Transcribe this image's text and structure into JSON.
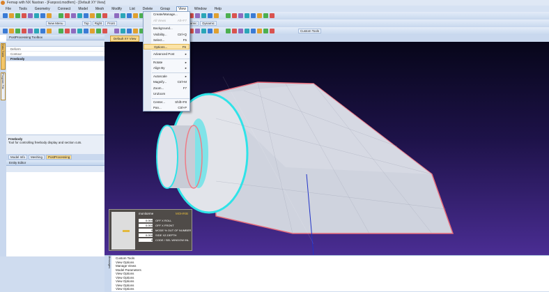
{
  "title": "Femap with NX Nastran - [Fanpost.modfem] - [Default XY View]",
  "menubar": [
    "File",
    "Tools",
    "Geometry",
    "Connect",
    "Model",
    "Mesh",
    "Modify",
    "List",
    "Delete",
    "Group",
    "View",
    "Window",
    "Help"
  ],
  "toolbar": {
    "new_menu": "New Menu",
    "top": "Top",
    "right": "Right",
    "front": "Front",
    "dynamic1": "Dynamic",
    "dynamic2": "Dynamic",
    "custom_tools": "Custom Tools"
  },
  "view_menu": [
    {
      "label": "Create/Manage...",
      "shortcut": ""
    },
    {
      "label": "All Views",
      "shortcut": "Alt+F7",
      "disabled": true
    },
    {
      "sep": true
    },
    {
      "label": "Background...",
      "shortcut": ""
    },
    {
      "label": "Visibility...",
      "shortcut": "Ctrl+Q"
    },
    {
      "label": "Select...",
      "shortcut": "F5"
    },
    {
      "label": "Options...",
      "shortcut": "F6",
      "highlight": true
    },
    {
      "sep": true
    },
    {
      "label": "Advanced Post",
      "shortcut": "▸"
    },
    {
      "sep": true
    },
    {
      "label": "Rotate",
      "shortcut": "▸"
    },
    {
      "label": "Align By",
      "shortcut": "▸"
    },
    {
      "sep": true
    },
    {
      "label": "Autoscale",
      "shortcut": "▸"
    },
    {
      "label": "Magnify...",
      "shortcut": "Ctrl+M"
    },
    {
      "label": "Zoom...",
      "shortcut": "F7"
    },
    {
      "label": "UnZoom",
      "shortcut": ""
    },
    {
      "sep": true
    },
    {
      "label": "Center...",
      "shortcut": "Shift+F8"
    },
    {
      "label": "Pan...",
      "shortcut": "Ctrl+P"
    }
  ],
  "left_panel": {
    "title": "PostProcessing Toolbox",
    "items": [
      "Deform",
      "Contour",
      "Freebody"
    ],
    "desc_title": "Freebody",
    "desc_text": "Tool for controlling freebody display and section cuts.",
    "tabs": [
      "Model Info",
      "Meshing",
      "PostProcessing"
    ],
    "entity_editor": "Entity Editor",
    "vtabs": [
      "Data Table",
      "Program File"
    ]
  },
  "view_tab": "Default XY View",
  "legend": {
    "brand": "monitorme",
    "brand2": "MOHRIB",
    "rows": [
      [
        "0.000",
        "OFF X ROLL"
      ],
      [
        "0.000",
        "OFF X FRONT"
      ],
      [
        "0",
        "MODE % OUT OF NUMBER"
      ],
      [
        "0.000",
        "SIDE XZ-DEPTH"
      ],
      [
        "0",
        "CODE / SEL WINDOW INL"
      ]
    ]
  },
  "messages": [
    "Custom Tools",
    "View Options",
    "Manage Views",
    "Model Parameters",
    "View Options",
    "View Options",
    "View Options",
    "View Options",
    "View Options"
  ],
  "msg_tab": "Messages"
}
